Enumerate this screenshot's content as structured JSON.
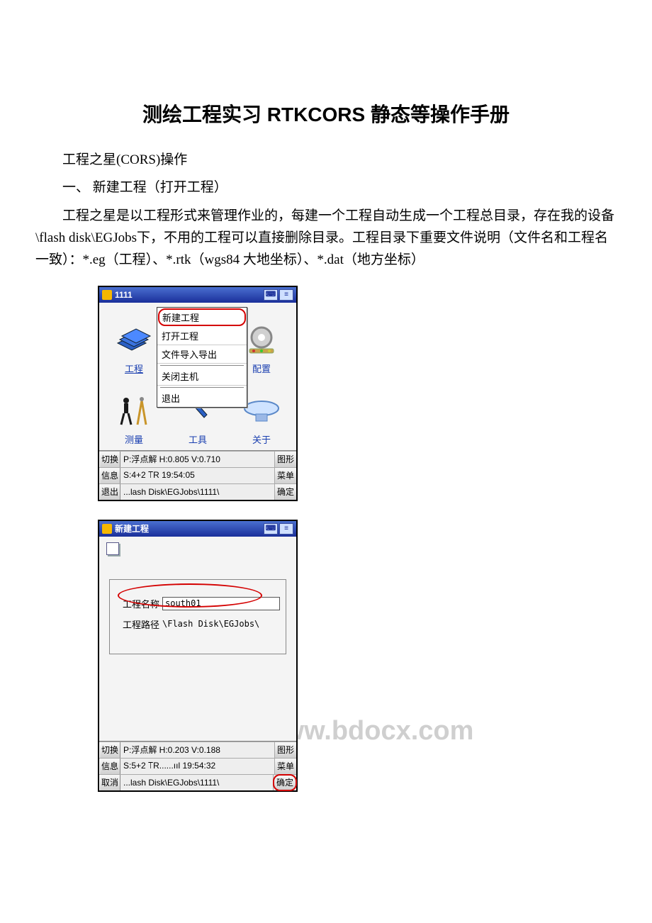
{
  "doc": {
    "title": "测绘工程实习 RTKCORS 静态等操作手册",
    "p1": "工程之星(CORS)操作",
    "p2": "一、 新建工程（打开工程）",
    "p3": "工程之星是以工程形式来管理作业的，每建一个工程自动生成一个工程总目录，存在我的设备\\flash disk\\EGJobs下，不用的工程可以直接删除目录。工程目录下重要文件说明（文件名和工程名一致）：*.eg（工程）、*.rtk（wgs84 大地坐标）、*.dat（地方坐标）"
  },
  "watermark": "www.bdocx.com",
  "shot1": {
    "title": "1111",
    "menu": {
      "item0": "新建工程",
      "item1": "打开工程",
      "item2": "文件导入导出",
      "item3": "关闭主机",
      "item4": "退出"
    },
    "grid": {
      "c0": "工程",
      "c1": "",
      "c2": "配置",
      "c3": "测量",
      "c4": "工具",
      "c5": "关于"
    },
    "status": {
      "r1_l": "切换",
      "r1_m": "P:浮点解  H:0.805  V:0.710",
      "r1_r": "图形",
      "r2_l": "信息",
      "r2_m": "S:4+2    ⟙R          19:54:05",
      "r2_r": "菜单",
      "r3_l": "退出",
      "r3_m": "...lash Disk\\EGJobs\\1111\\",
      "r3_r": "确定"
    }
  },
  "shot2": {
    "title": "新建工程",
    "form": {
      "label_name": "工程名称",
      "value_name": "south01",
      "label_path": "工程路径",
      "value_path": "\\Flash Disk\\EGJobs\\"
    },
    "status": {
      "r1_l": "切换",
      "r1_m": "P:浮点解  H:0.203  V:0.188",
      "r1_r": "图形",
      "r2_l": "信息",
      "r2_m": "S:5+2   ⟙R......ııl 19:54:32",
      "r2_r": "菜单",
      "r3_l": "取消",
      "r3_m": "...lash Disk\\EGJobs\\1111\\",
      "r3_r": "确定"
    }
  }
}
